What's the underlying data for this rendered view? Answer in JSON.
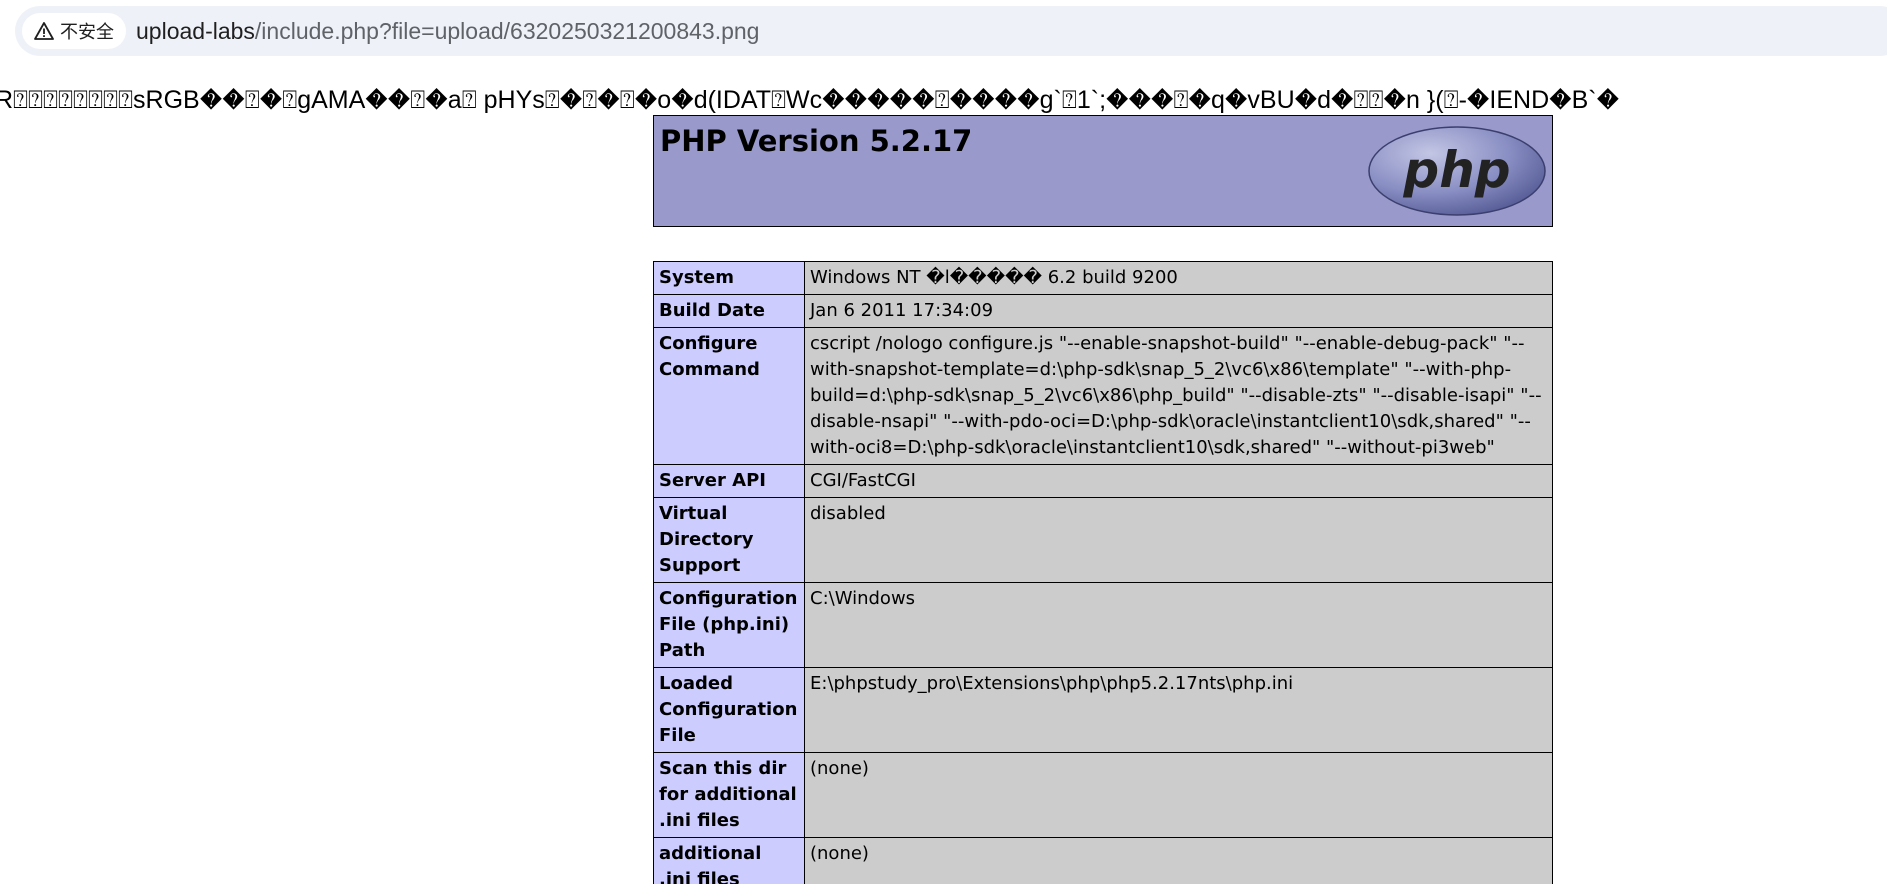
{
  "browser": {
    "security_label": "不安全",
    "url_host": "upload-labs",
    "url_path": "/include.php?file=upload/6320250321200843.png"
  },
  "raw_output": "R⍰⍰⍰⍰⍰⍰⍰⍰sRGB��⍰�⍰gAMA��⍰�a⍰ pHYs⍰�⍰�⍰�o�d(IDAT⍰Wc�����⍰����g`⍰1`;���⍰�q�vBU�d�⍰⍰�n }(⍰-�IEND�B`�",
  "phpinfo": {
    "title": "PHP Version 5.2.17",
    "logo_text": "php",
    "rows": [
      {
        "name": "System",
        "value": "Windows NT �l����� 6.2 build 9200"
      },
      {
        "name": "Build Date",
        "value": "Jan 6 2011 17:34:09"
      },
      {
        "name": "Configure Command",
        "value": "cscript /nologo configure.js \"--enable-snapshot-build\" \"--enable-debug-pack\" \"--with-snapshot-template=d:\\php-sdk\\snap_5_2\\vc6\\x86\\template\" \"--with-php-build=d:\\php-sdk\\snap_5_2\\vc6\\x86\\php_build\" \"--disable-zts\" \"--disable-isapi\" \"--disable-nsapi\" \"--with-pdo-oci=D:\\php-sdk\\oracle\\instantclient10\\sdk,shared\" \"--with-oci8=D:\\php-sdk\\oracle\\instantclient10\\sdk,shared\" \"--without-pi3web\""
      },
      {
        "name": "Server API",
        "value": "CGI/FastCGI"
      },
      {
        "name": "Virtual Directory Support",
        "value": "disabled"
      },
      {
        "name": "Configuration File (php.ini) Path",
        "value": "C:\\Windows"
      },
      {
        "name": "Loaded Configuration File",
        "value": "E:\\phpstudy_pro\\Extensions\\php\\php5.2.17nts\\php.ini"
      },
      {
        "name": "Scan this dir for additional .ini files",
        "value": "(none)"
      },
      {
        "name": "additional .ini files parsed",
        "value": "(none)"
      }
    ]
  },
  "colors": {
    "header_bg": "#9999cc",
    "label_bg": "#ccccff",
    "value_bg": "#cccccc",
    "omnibox_bg": "#eef1f8"
  }
}
